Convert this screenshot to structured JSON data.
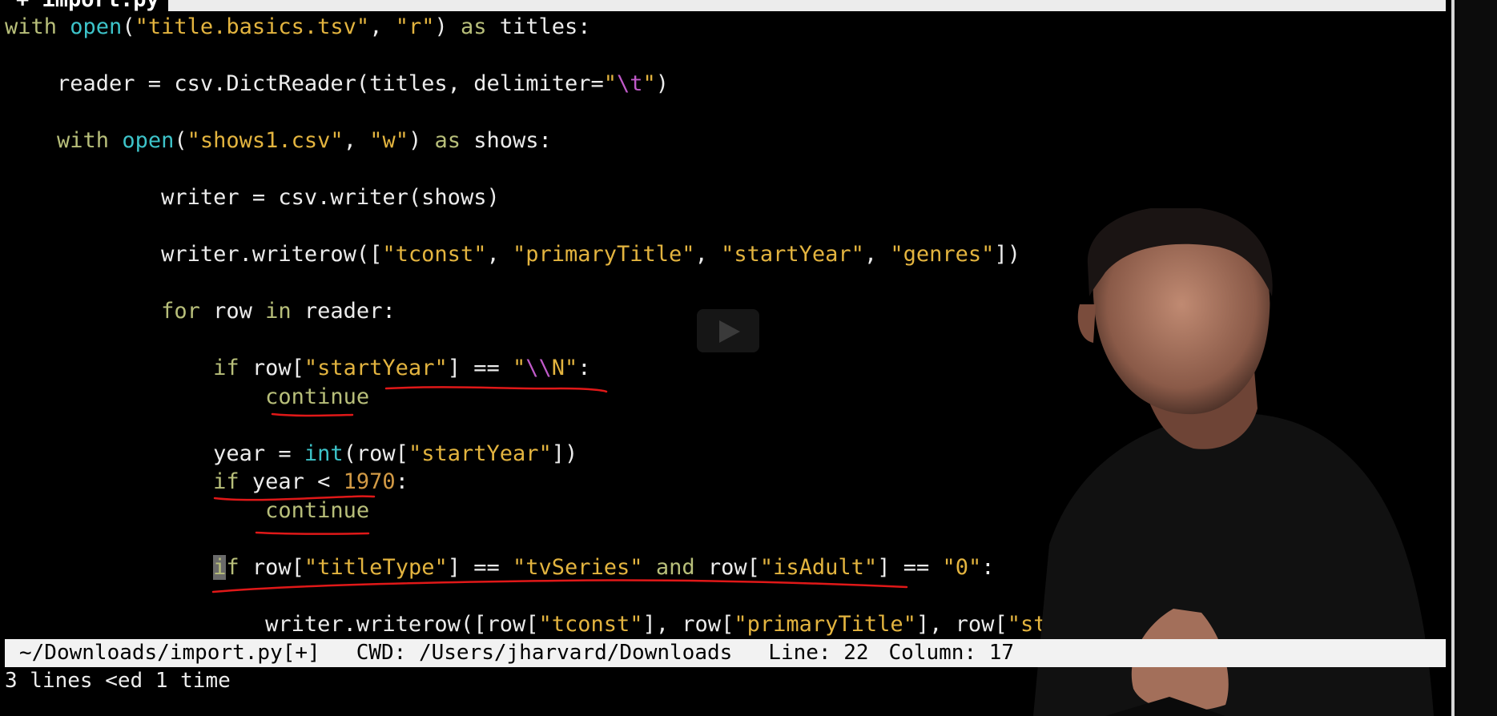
{
  "tab": {
    "label": "+ import.py"
  },
  "code_lines": [
    [
      {
        "t": "with ",
        "c": "kw"
      },
      {
        "t": "open",
        "c": "fn"
      },
      {
        "t": "(",
        "c": "pl"
      },
      {
        "t": "\"title.basics.tsv\"",
        "c": "str"
      },
      {
        "t": ", ",
        "c": "pl"
      },
      {
        "t": "\"r\"",
        "c": "str"
      },
      {
        "t": ") ",
        "c": "pl"
      },
      {
        "t": "as",
        "c": "kw"
      },
      {
        "t": " titles:",
        "c": "pl"
      }
    ],
    [],
    [
      {
        "t": "    reader = csv.DictReader(titles, delimiter=",
        "c": "pl"
      },
      {
        "t": "\"",
        "c": "str"
      },
      {
        "t": "\\t",
        "c": "esc"
      },
      {
        "t": "\"",
        "c": "str"
      },
      {
        "t": ")",
        "c": "pl"
      }
    ],
    [],
    [
      {
        "t": "    ",
        "c": "pl"
      },
      {
        "t": "with ",
        "c": "kw"
      },
      {
        "t": "open",
        "c": "fn"
      },
      {
        "t": "(",
        "c": "pl"
      },
      {
        "t": "\"shows1.csv\"",
        "c": "str"
      },
      {
        "t": ", ",
        "c": "pl"
      },
      {
        "t": "\"w\"",
        "c": "str"
      },
      {
        "t": ") ",
        "c": "pl"
      },
      {
        "t": "as",
        "c": "kw"
      },
      {
        "t": " shows:",
        "c": "pl"
      }
    ],
    [],
    [
      {
        "t": "            writer = csv.writer(shows)",
        "c": "pl"
      }
    ],
    [],
    [
      {
        "t": "            writer.writerow([",
        "c": "pl"
      },
      {
        "t": "\"tconst\"",
        "c": "str"
      },
      {
        "t": ", ",
        "c": "pl"
      },
      {
        "t": "\"primaryTitle\"",
        "c": "str"
      },
      {
        "t": ", ",
        "c": "pl"
      },
      {
        "t": "\"startYear\"",
        "c": "str"
      },
      {
        "t": ", ",
        "c": "pl"
      },
      {
        "t": "\"genres\"",
        "c": "str"
      },
      {
        "t": "])",
        "c": "pl"
      }
    ],
    [],
    [
      {
        "t": "            ",
        "c": "pl"
      },
      {
        "t": "for",
        "c": "kw"
      },
      {
        "t": " row ",
        "c": "pl"
      },
      {
        "t": "in",
        "c": "kw"
      },
      {
        "t": " reader:",
        "c": "pl"
      }
    ],
    [],
    [
      {
        "t": "                ",
        "c": "pl"
      },
      {
        "t": "if",
        "c": "kw"
      },
      {
        "t": " row[",
        "c": "pl"
      },
      {
        "t": "\"startYear\"",
        "c": "str"
      },
      {
        "t": "] == ",
        "c": "pl"
      },
      {
        "t": "\"",
        "c": "str"
      },
      {
        "t": "\\\\",
        "c": "esc"
      },
      {
        "t": "N\"",
        "c": "str"
      },
      {
        "t": ":",
        "c": "pl"
      }
    ],
    [
      {
        "t": "                    ",
        "c": "pl"
      },
      {
        "t": "continue",
        "c": "kw"
      }
    ],
    [],
    [
      {
        "t": "                year = ",
        "c": "pl"
      },
      {
        "t": "int",
        "c": "fn"
      },
      {
        "t": "(row[",
        "c": "pl"
      },
      {
        "t": "\"startYear\"",
        "c": "str"
      },
      {
        "t": "])",
        "c": "pl"
      }
    ],
    [
      {
        "t": "                ",
        "c": "pl"
      },
      {
        "t": "if",
        "c": "kw"
      },
      {
        "t": " year < ",
        "c": "pl"
      },
      {
        "t": "1970",
        "c": "num"
      },
      {
        "t": ":",
        "c": "pl"
      }
    ],
    [
      {
        "t": "                    ",
        "c": "pl"
      },
      {
        "t": "continue",
        "c": "kw"
      }
    ],
    [],
    [
      {
        "t": "                ",
        "c": "pl"
      },
      {
        "t": "i",
        "c": "kw cursor"
      },
      {
        "t": "f",
        "c": "kw"
      },
      {
        "t": " row[",
        "c": "pl"
      },
      {
        "t": "\"titleType\"",
        "c": "str"
      },
      {
        "t": "] == ",
        "c": "pl"
      },
      {
        "t": "\"tvSeries\"",
        "c": "str"
      },
      {
        "t": " ",
        "c": "pl"
      },
      {
        "t": "and",
        "c": "kw"
      },
      {
        "t": " row[",
        "c": "pl"
      },
      {
        "t": "\"isAdult\"",
        "c": "str"
      },
      {
        "t": "] == ",
        "c": "pl"
      },
      {
        "t": "\"0\"",
        "c": "str"
      },
      {
        "t": ":",
        "c": "pl"
      }
    ],
    [],
    [
      {
        "t": "                    writer.writerow([row[",
        "c": "pl"
      },
      {
        "t": "\"tconst\"",
        "c": "str"
      },
      {
        "t": "], row[",
        "c": "pl"
      },
      {
        "t": "\"primaryTitle\"",
        "c": "str"
      },
      {
        "t": "], row[",
        "c": "pl"
      },
      {
        "t": "\"star",
        "c": "str"
      }
    ]
  ],
  "status_bar": {
    "path": "~/Downloads/import.py[+]",
    "cwd": "CWD: /Users/jharvard/Downloads",
    "line": "Line: 22",
    "column": "Column: 17"
  },
  "message_line": "3 lines <ed 1 time",
  "colors": {
    "keyword": "#b8bf7a",
    "function": "#3dc3c9",
    "string": "#e3b43f",
    "escape": "#c05ac9",
    "number": "#d29a45",
    "annotation_ink": "#e01818"
  },
  "icons": {
    "play": "play-icon"
  }
}
